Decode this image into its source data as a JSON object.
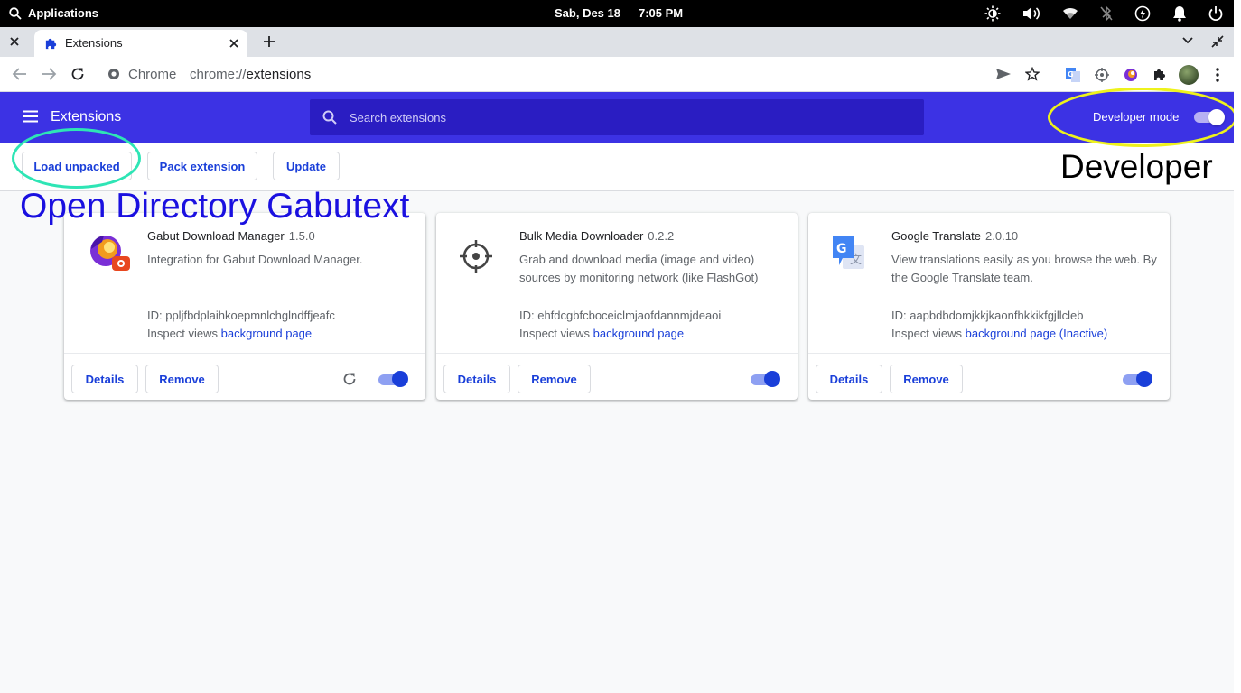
{
  "os": {
    "apps_label": "Applications",
    "date": "Sab, Des 18",
    "time": "7:05 PM",
    "tray_icons": [
      "brightness-icon",
      "volume-icon",
      "wifi-icon",
      "bluetooth-off-icon",
      "power-profile-icon",
      "notification-bell-icon",
      "power-icon"
    ]
  },
  "browser": {
    "tab_title": "Extensions",
    "omnibox_scheme": "Chrome",
    "omnibox_url_prefix": "chrome://",
    "omnibox_url_host": "extensions"
  },
  "extensions_page": {
    "title": "Extensions",
    "search_placeholder": "Search extensions",
    "developer_mode_label": "Developer mode",
    "developer_mode_on": true,
    "actions": {
      "load_unpacked": "Load unpacked",
      "pack_extension": "Pack extension",
      "update": "Update"
    },
    "cards": [
      {
        "name": "Gabut Download Manager",
        "version": "1.5.0",
        "description": "Integration for Gabut Download Manager.",
        "id": "ID: ppljfbdplaihkoepmnlchglndffjeafc",
        "inspect_label": "Inspect views",
        "inspect_link": "background page",
        "details": "Details",
        "remove": "Remove",
        "enabled": true,
        "icon": "gabut-logo-icon"
      },
      {
        "name": "Bulk Media Downloader",
        "version": "0.2.2",
        "description": "Grab and download media (image and video) sources by monitoring network (like FlashGot)",
        "id": "ID: ehfdcgbfcboceiclmjaofdannmjdeaoi",
        "inspect_label": "Inspect views",
        "inspect_link": "background page",
        "details": "Details",
        "remove": "Remove",
        "enabled": true,
        "icon": "crosshair-icon"
      },
      {
        "name": "Google Translate",
        "version": "2.0.10",
        "description": "View translations easily as you browse the web. By the Google Translate team.",
        "id": "ID: aapbdbdomjkkjkaonfhkkikfgjllcleb",
        "inspect_label": "Inspect views",
        "inspect_link": "background page (Inactive)",
        "details": "Details",
        "remove": "Remove",
        "enabled": true,
        "icon": "google-translate-icon"
      }
    ]
  },
  "annotations": {
    "developer": "Developer",
    "open_directory": "Open Directory Gabutext"
  },
  "colors": {
    "header_blue": "#3c32e4",
    "link_blue": "#1a3fd9",
    "highlight_yellow": "#eef21c",
    "highlight_teal": "#2ee5b5",
    "annotation_blue": "#1a10e0"
  }
}
